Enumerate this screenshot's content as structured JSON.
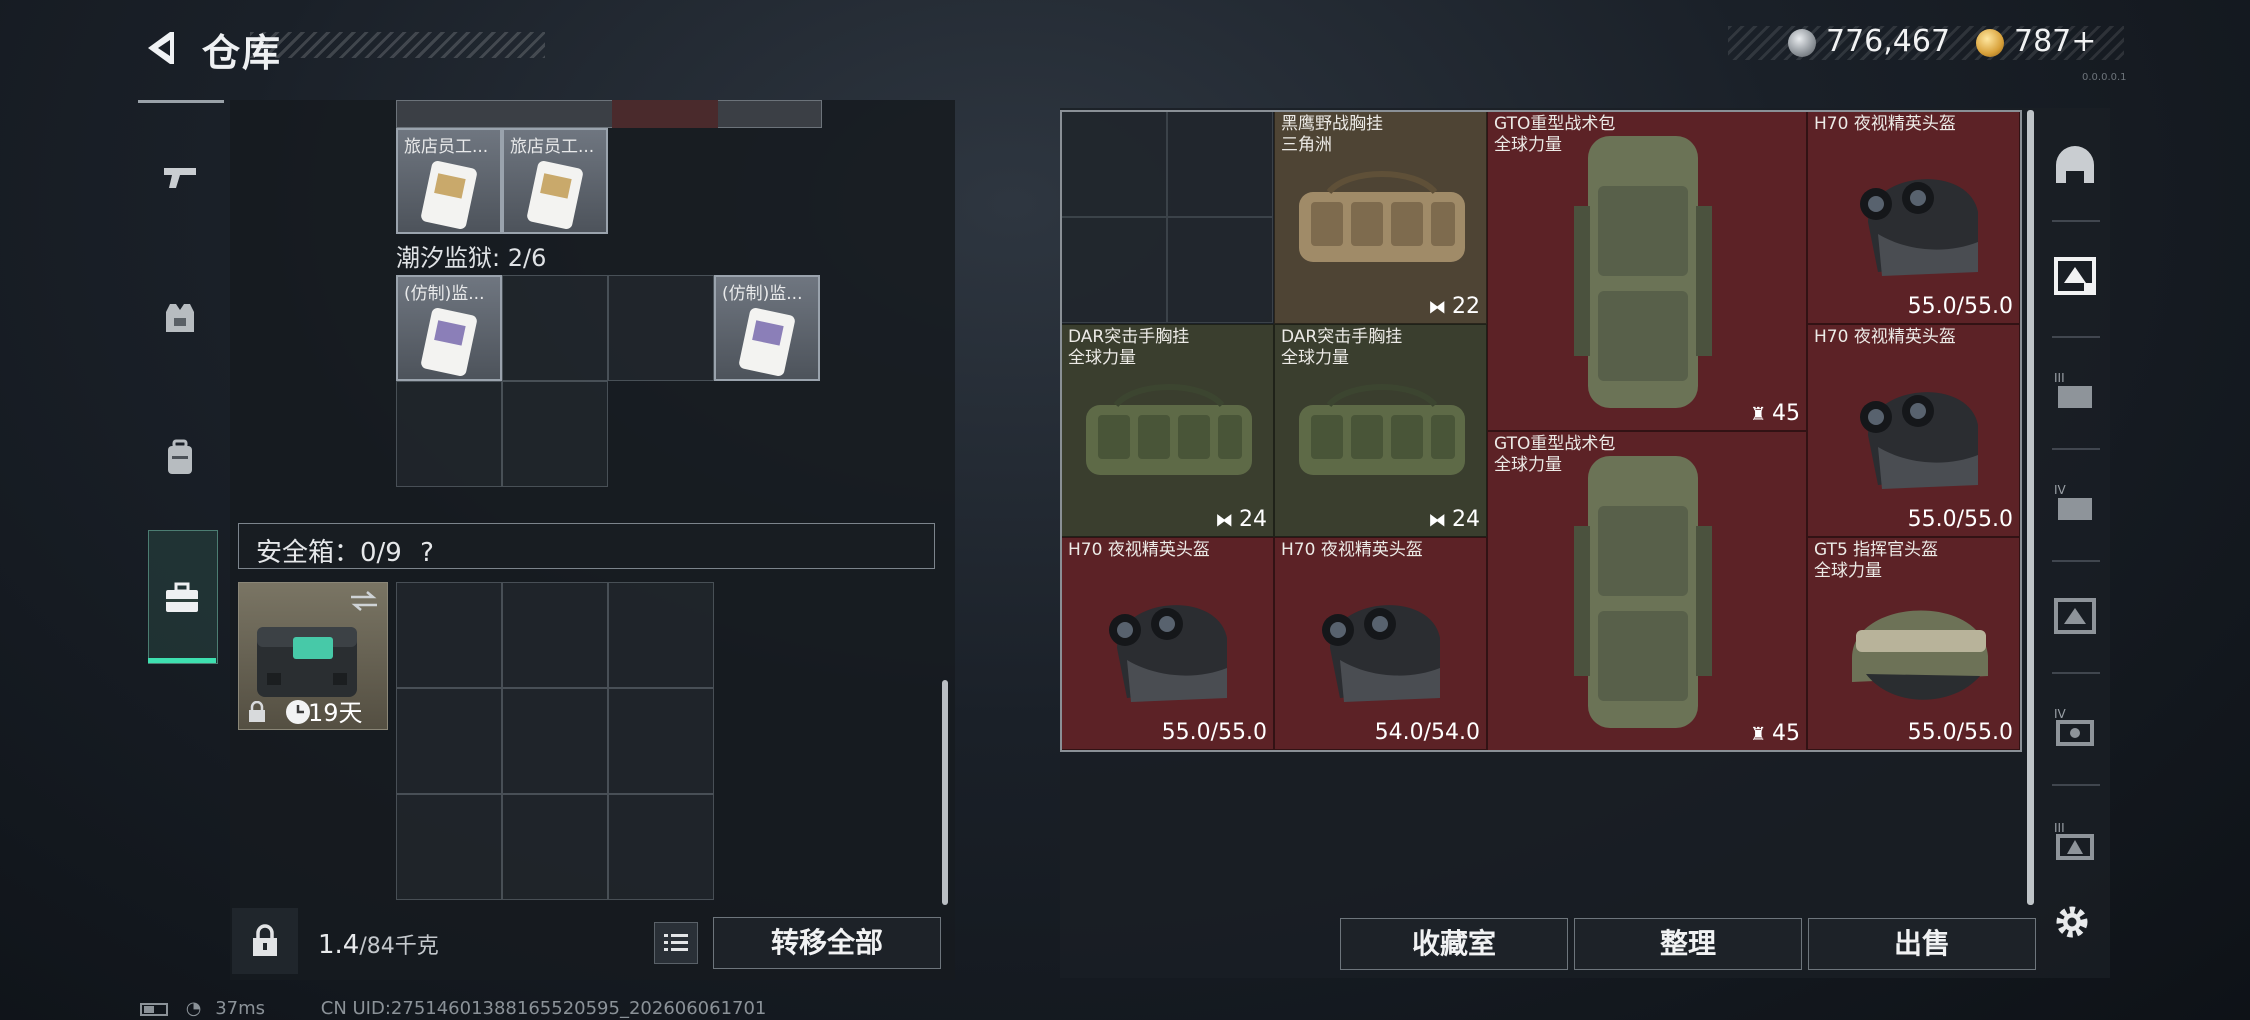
{
  "header": {
    "title": "仓库",
    "back_icon": "back-arrow-icon"
  },
  "currency": {
    "silver_value": "776,467",
    "gold_value": "787+",
    "silver_icon": "silver-coin-icon",
    "gold_icon": "gold-coin-icon"
  },
  "version": "0.0.0.0.1",
  "left_nav": [
    {
      "icon": "pistol-icon",
      "selected": false
    },
    {
      "icon": "vest-icon",
      "selected": false
    },
    {
      "icon": "backpack-icon",
      "selected": false
    },
    {
      "icon": "briefcase-icon",
      "selected": true
    }
  ],
  "storage": {
    "top_items": [
      {
        "label": "旅店员工..."
      },
      {
        "label": "旅店员工..."
      }
    ],
    "section_label": "潮汐监狱: 2/6",
    "section_items": [
      {
        "label": "(仿制)监..."
      },
      {
        "label": "(仿制)监..."
      }
    ]
  },
  "safebox": {
    "label": "安全箱：0/9",
    "help": "?",
    "days": "19天",
    "swap_icon": "swap-icon"
  },
  "bottom": {
    "weight_value": "1.4",
    "weight_max": "/84千克",
    "transfer_all": "转移全部"
  },
  "right_items": [
    {
      "name": "黑鹰野战胸挂",
      "sub": "三角洲",
      "badge": "22",
      "badge_icon": "vest-icon"
    },
    {
      "name": "GTO重型战术包",
      "sub": "全球力量",
      "badge": "45",
      "badge_icon": "backpack-icon"
    },
    {
      "name": "H70 夜视精英头盔",
      "sub": "",
      "durability": "55.0/55.0"
    },
    {
      "name": "DAR突击手胸挂",
      "sub": "全球力量",
      "badge": "24",
      "badge_icon": "vest-icon"
    },
    {
      "name": "DAR突击手胸挂",
      "sub": "全球力量",
      "badge": "24",
      "badge_icon": "vest-icon"
    },
    {
      "name": "H70 夜视精英头盔",
      "sub": "",
      "durability": "55.0/55.0"
    },
    {
      "name": "GTO重型战术包",
      "sub": "全球力量",
      "badge": "45",
      "badge_icon": "backpack-icon"
    },
    {
      "name": "H70 夜视精英头盔",
      "sub": "",
      "durability": "55.0/55.0"
    },
    {
      "name": "H70 夜视精英头盔",
      "sub": "",
      "durability": "54.0/54.0"
    },
    {
      "name": "GT5 指挥官头盔",
      "sub": "全球力量",
      "durability": "55.0/55.0"
    }
  ],
  "right_tabs": [
    {
      "icon": "helmet-icon"
    },
    {
      "icon": "armor-box-icon"
    },
    {
      "icon": "tier3-icon"
    },
    {
      "icon": "tier4-icon"
    },
    {
      "icon": "warehouse-icon"
    },
    {
      "icon": "tier4-chip-icon"
    },
    {
      "icon": "tier3-warning-icon"
    }
  ],
  "actions": {
    "collection": "收藏室",
    "organize": "整理",
    "sell": "出售",
    "settings_icon": "gear-icon"
  },
  "status": {
    "ping": "37ms",
    "uid": "CN UID:27514601388165520595_202606061701"
  },
  "colors": {
    "accent": "#3ee0b0",
    "item_red": "#5c2226",
    "item_tan": "#4e4434",
    "item_green": "#3a3e2e"
  }
}
